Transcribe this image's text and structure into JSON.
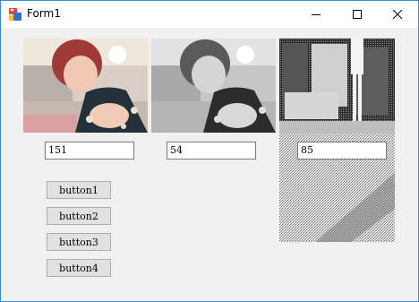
{
  "window": {
    "title": "Form1",
    "icon": "winforms-app-icon"
  },
  "titlebar_buttons": [
    "minimize-icon",
    "maximize-icon",
    "close-icon"
  ],
  "textboxes": {
    "box1": "151",
    "box2": "54",
    "box3": "85"
  },
  "buttons": {
    "b1": "button1",
    "b2": "button2",
    "b3": "button3",
    "b4": "button4"
  },
  "images": [
    {
      "name": "original-color-photo",
      "mode": "color"
    },
    {
      "name": "grayscale-photo",
      "mode": "grayscale"
    },
    {
      "name": "binarized-street-photo",
      "mode": "dithered-monochrome"
    }
  ],
  "colors": {
    "title_border": "#3a8ad6",
    "form_bg": "#f0f0f0"
  }
}
